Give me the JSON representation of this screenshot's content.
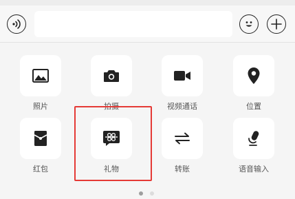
{
  "input_bar": {
    "voice_icon": "voice-icon",
    "text_value": "",
    "text_placeholder": "",
    "emoji_icon": "smiley-icon",
    "plus_icon": "plus-icon"
  },
  "panel": {
    "items": [
      {
        "label": "照片",
        "icon": "photo-icon"
      },
      {
        "label": "拍摄",
        "icon": "camera-icon"
      },
      {
        "label": "视频通话",
        "icon": "video-call-icon"
      },
      {
        "label": "位置",
        "icon": "location-icon"
      },
      {
        "label": "红包",
        "icon": "red-packet-icon"
      },
      {
        "label": "礼物",
        "icon": "gift-icon"
      },
      {
        "label": "转账",
        "icon": "transfer-icon"
      },
      {
        "label": "语音输入",
        "icon": "voice-input-icon"
      }
    ],
    "highlighted_item": "礼物",
    "page_indicator": {
      "pages": 2,
      "current": 1
    }
  },
  "colors": {
    "highlight": "#e53935",
    "icon": "#222222",
    "tile": "#ffffff",
    "background": "#f5f5f5"
  }
}
